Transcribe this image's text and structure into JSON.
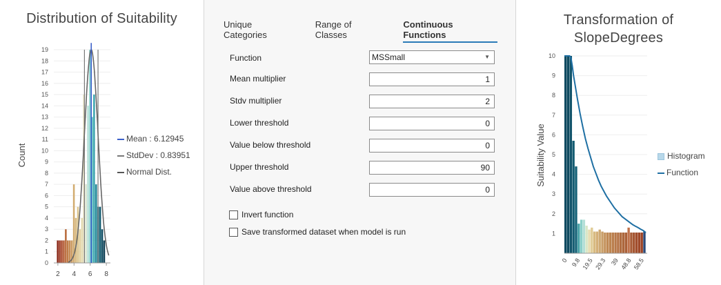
{
  "left": {
    "title": "Distribution of Suitability",
    "ylabel": "Count",
    "legend": {
      "mean": "Mean : 6.12945",
      "stddev": "StdDev : 0.83951",
      "normal": "Normal Dist."
    }
  },
  "tabs": [
    "Unique Categories",
    "Range of Classes",
    "Continuous Functions"
  ],
  "active_tab": "Continuous Functions",
  "form": {
    "function_label": "Function",
    "function_value": "MSSmall",
    "rows": [
      {
        "label": "Mean multiplier",
        "value": "1"
      },
      {
        "label": "Stdv multiplier",
        "value": "2"
      },
      {
        "label": "Lower threshold",
        "value": "0"
      },
      {
        "label": "Value below threshold",
        "value": "0"
      },
      {
        "label": "Upper threshold",
        "value": "90"
      },
      {
        "label": "Value above threshold",
        "value": "0"
      }
    ],
    "invert_label": "Invert function",
    "save_label": "Save transformed dataset when model is run",
    "invert_checked": false,
    "save_checked": false
  },
  "right": {
    "title_line1": "Transformation of",
    "title_line2": "SlopeDegrees",
    "ylabel": "Suitability Value",
    "legend": {
      "histogram": "Histogram",
      "function": "Function"
    }
  },
  "colors": {
    "accent": "#2a7ab8",
    "mean_line": "#3b5fc9",
    "normal_curve": "#666666",
    "function_line": "#1e6fa3",
    "histogram_legend": "#b8d8ea"
  },
  "chart_data": [
    {
      "type": "bar",
      "title": "Distribution of Suitability",
      "ylabel": "Count",
      "xlim": [
        1.5,
        8.5
      ],
      "ylim": [
        0,
        19
      ],
      "x_ticks": [
        2,
        4,
        6,
        8
      ],
      "y_ticks": [
        0,
        1,
        2,
        3,
        4,
        5,
        6,
        7,
        8,
        9,
        10,
        11,
        12,
        13,
        14,
        15,
        16,
        17,
        18,
        19
      ],
      "bins": [
        {
          "x": 2.0,
          "value": 2,
          "color": "#8b2a1a"
        },
        {
          "x": 2.25,
          "value": 2,
          "color": "#9d3a24"
        },
        {
          "x": 2.5,
          "value": 2,
          "color": "#aa4a2c"
        },
        {
          "x": 2.75,
          "value": 2,
          "color": "#b45c35"
        },
        {
          "x": 3.0,
          "value": 3,
          "color": "#b86a3a"
        },
        {
          "x": 3.25,
          "value": 2,
          "color": "#bd7842"
        },
        {
          "x": 3.5,
          "value": 2,
          "color": "#c48a52"
        },
        {
          "x": 3.75,
          "value": 2,
          "color": "#cc9c62"
        },
        {
          "x": 4.0,
          "value": 7,
          "color": "#d2ac70"
        },
        {
          "x": 4.25,
          "value": 4,
          "color": "#d8ba80"
        },
        {
          "x": 4.5,
          "value": 5,
          "color": "#dcc690"
        },
        {
          "x": 4.75,
          "value": 3,
          "color": "#e1d09f"
        },
        {
          "x": 5.0,
          "value": 4,
          "color": "#e4dab0"
        },
        {
          "x": 5.25,
          "value": 15,
          "color": "#e2ddbc"
        },
        {
          "x": 5.5,
          "value": 7,
          "color": "#dce7d2"
        },
        {
          "x": 5.75,
          "value": 14,
          "color": "#b5e0d8"
        },
        {
          "x": 6.0,
          "value": 19,
          "color": "#8ad3cf"
        },
        {
          "x": 6.25,
          "value": 13,
          "color": "#5cbcc0"
        },
        {
          "x": 6.5,
          "value": 15,
          "color": "#3aa4ad"
        },
        {
          "x": 6.75,
          "value": 7,
          "color": "#23899a"
        },
        {
          "x": 7.0,
          "value": 5,
          "color": "#1b7185"
        },
        {
          "x": 7.25,
          "value": 5,
          "color": "#155d72"
        },
        {
          "x": 7.5,
          "value": 3,
          "color": "#124e63"
        },
        {
          "x": 7.75,
          "value": 2,
          "color": "#0f4055"
        }
      ],
      "mean": 6.12945,
      "stddev": 0.83951,
      "series": [
        {
          "name": "Mean : 6.12945"
        },
        {
          "name": "StdDev : 0.83951"
        },
        {
          "name": "Normal Dist."
        }
      ]
    },
    {
      "type": "bar",
      "title": "Transformation of SlopeDegrees",
      "ylabel": "Suitability Value",
      "xlim": [
        0,
        63
      ],
      "ylim": [
        0,
        10
      ],
      "y_ticks": [
        1,
        2,
        3,
        4,
        5,
        6,
        7,
        8,
        9,
        10
      ],
      "x_ticks": [
        "0",
        "9.8",
        "19.5",
        "29.3",
        "39",
        "48.8",
        "58.5"
      ],
      "x_tick_values": [
        0,
        9.8,
        19.5,
        29.3,
        39,
        48.8,
        58.5
      ],
      "histogram": [
        {
          "x": 0,
          "value": 10,
          "color": "#0f4a60"
        },
        {
          "x": 2,
          "value": 10,
          "color": "#0f4a60"
        },
        {
          "x": 4,
          "value": 10,
          "color": "#12546b"
        },
        {
          "x": 6,
          "value": 5.7,
          "color": "#145c72"
        },
        {
          "x": 8,
          "value": 4.4,
          "color": "#176378"
        },
        {
          "x": 10,
          "value": 1.5,
          "color": "#4ba4a8"
        },
        {
          "x": 12,
          "value": 1.7,
          "color": "#8bd0c9"
        },
        {
          "x": 14,
          "value": 1.7,
          "color": "#b3dfd6"
        },
        {
          "x": 16,
          "value": 1.4,
          "color": "#d7e7c7"
        },
        {
          "x": 18,
          "value": 1.2,
          "color": "#e6dcb1"
        },
        {
          "x": 20,
          "value": 1.3,
          "color": "#e0cc96"
        },
        {
          "x": 22,
          "value": 1.1,
          "color": "#d8ba80"
        },
        {
          "x": 24,
          "value": 1.1,
          "color": "#d4b078"
        },
        {
          "x": 26,
          "value": 1.2,
          "color": "#ceaa74"
        },
        {
          "x": 28,
          "value": 1.1,
          "color": "#c99e68"
        },
        {
          "x": 30,
          "value": 1.05,
          "color": "#c4925c"
        },
        {
          "x": 32,
          "value": 1.05,
          "color": "#c08a55"
        },
        {
          "x": 34,
          "value": 1.05,
          "color": "#bd8450"
        },
        {
          "x": 36,
          "value": 1.05,
          "color": "#ba7e4c"
        },
        {
          "x": 38,
          "value": 1.05,
          "color": "#b77848"
        },
        {
          "x": 40,
          "value": 1.05,
          "color": "#b47244"
        },
        {
          "x": 42,
          "value": 1.05,
          "color": "#b06c40"
        },
        {
          "x": 44,
          "value": 1.05,
          "color": "#ad663c"
        },
        {
          "x": 46,
          "value": 1.05,
          "color": "#aa6038"
        },
        {
          "x": 48,
          "value": 1.3,
          "color": "#c0714a"
        },
        {
          "x": 50,
          "value": 1.05,
          "color": "#a75a34"
        },
        {
          "x": 52,
          "value": 1.05,
          "color": "#a45430"
        },
        {
          "x": 54,
          "value": 1.05,
          "color": "#a14e2c"
        },
        {
          "x": 56,
          "value": 1.05,
          "color": "#9e4828"
        },
        {
          "x": 58,
          "value": 1.05,
          "color": "#9b4224"
        },
        {
          "x": 60,
          "value": 1.1,
          "color": "#2b4a7a"
        }
      ],
      "function": {
        "name": "Function",
        "x": [
          0,
          4,
          5,
          6,
          7,
          8,
          9,
          10,
          12,
          14,
          16,
          18,
          20,
          22,
          24,
          26,
          28,
          30,
          32,
          34,
          36,
          38,
          40,
          42,
          44,
          46,
          48,
          50,
          52,
          54,
          56,
          58,
          60,
          62
        ],
        "y": [
          10,
          10,
          9.9,
          9.5,
          9.0,
          8.6,
          8.2,
          7.8,
          7.05,
          6.4,
          5.8,
          5.3,
          4.85,
          4.4,
          4.05,
          3.7,
          3.4,
          3.15,
          2.9,
          2.7,
          2.5,
          2.3,
          2.15,
          2.0,
          1.85,
          1.75,
          1.65,
          1.55,
          1.45,
          1.37,
          1.3,
          1.22,
          1.15,
          1.05
        ]
      },
      "series": [
        {
          "name": "Histogram"
        },
        {
          "name": "Function"
        }
      ]
    }
  ]
}
